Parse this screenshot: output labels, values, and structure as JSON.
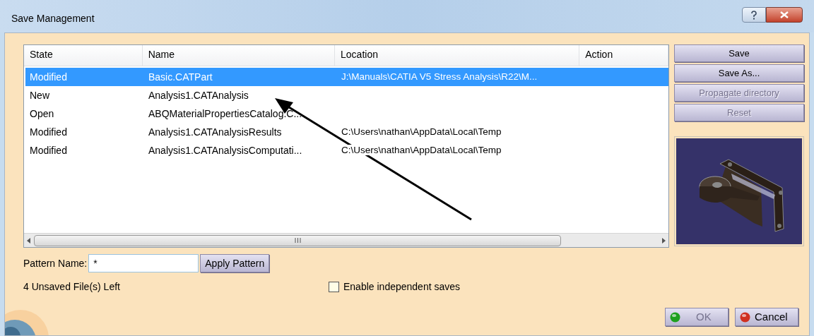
{
  "window": {
    "title": "Save Management"
  },
  "table": {
    "columns": [
      "State",
      "Name",
      "Location",
      "Action"
    ],
    "rows": [
      {
        "state": "Modified",
        "name": "Basic.CATPart",
        "location": "J:\\Manuals\\CATIA V5 Stress Analysis\\R22\\M...",
        "selected": true
      },
      {
        "state": "New",
        "name": "Analysis1.CATAnalysis",
        "location": "",
        "selected": false
      },
      {
        "state": "Open",
        "name": "ABQMaterialPropertiesCatalog.C...",
        "location": "",
        "selected": false
      },
      {
        "state": "Modified",
        "name": "Analysis1.CATAnalysisResults",
        "location": "C:\\Users\\nathan\\AppData\\Local\\Temp",
        "selected": false
      },
      {
        "state": "Modified",
        "name": "Analysis1.CATAnalysisComputati...",
        "location": "C:\\Users\\nathan\\AppData\\Local\\Temp",
        "selected": false
      }
    ]
  },
  "side_buttons": [
    {
      "label": "Save",
      "disabled": false
    },
    {
      "label": "Save As...",
      "disabled": false
    },
    {
      "label": "Propagate directory",
      "disabled": true
    },
    {
      "label": "Reset",
      "disabled": true
    }
  ],
  "pattern": {
    "label": "Pattern Name:",
    "value": "*",
    "button": "Apply Pattern"
  },
  "status": "4 Unsaved File(s) Left",
  "independent_saves": {
    "label": "Enable independent saves",
    "checked": false
  },
  "footer_buttons": [
    {
      "kind": "ok",
      "label": "OK",
      "disabled": true
    },
    {
      "kind": "cancel",
      "label": "Cancel",
      "disabled": false
    }
  ]
}
